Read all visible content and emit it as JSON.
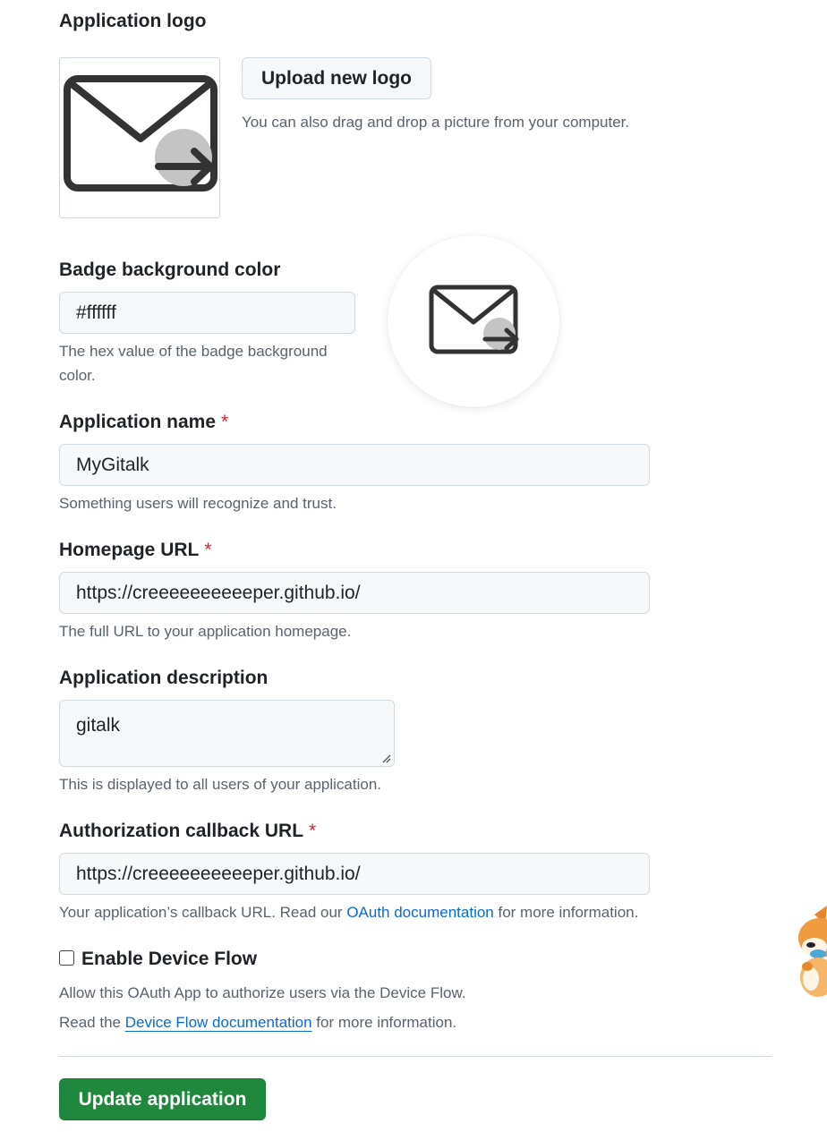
{
  "logo": {
    "heading": "Application logo",
    "upload_label": "Upload new logo",
    "drag_hint": "You can also drag and drop a picture from your computer.",
    "icon": "mail-forward-icon"
  },
  "badge": {
    "label": "Badge background color",
    "value": "#ffffff",
    "note_line1": "The hex value of the badge background",
    "note_line2": "color."
  },
  "app_name": {
    "label": "Application name",
    "required": "*",
    "value": "MyGitalk",
    "note": "Something users will recognize and trust."
  },
  "homepage": {
    "label": "Homepage URL",
    "required": "*",
    "value": "https://creeeeeeeeeeper.github.io/",
    "note": "The full URL to your application homepage."
  },
  "description": {
    "label": "Application description",
    "value": "gitalk",
    "note": "This is displayed to all users of your application."
  },
  "callback": {
    "label": "Authorization callback URL",
    "required": "*",
    "value": "https://creeeeeeeeeeper.github.io/",
    "note_prefix": "Your application’s callback URL. Read our ",
    "note_link": "OAuth documentation",
    "note_suffix": " for more information."
  },
  "device_flow": {
    "label": "Enable Device Flow",
    "checked": false,
    "note": "Allow this OAuth App to authorize users via the Device Flow.",
    "read_prefix": "Read the ",
    "read_link": "Device Flow documentation",
    "read_suffix": " for more information."
  },
  "submit": {
    "label": "Update application"
  },
  "colors": {
    "primary": "#1f883d",
    "link": "#0969da",
    "required": "#d1242f",
    "muted_text": "#59636e",
    "input_bg": "#f6f8fa",
    "border": "#d1d9e0"
  }
}
